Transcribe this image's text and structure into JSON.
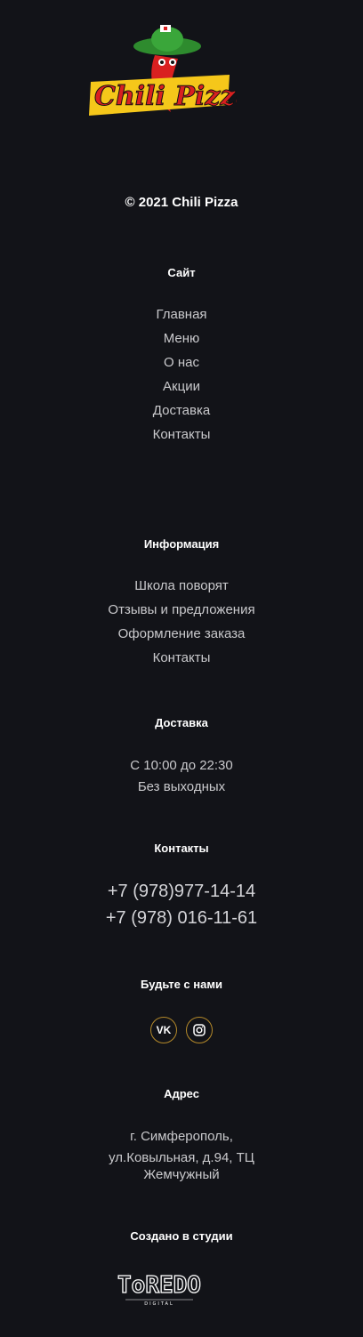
{
  "footer": {
    "logo_text": "Chili Pizza",
    "copyright": "© 2021 Chili Pizza",
    "site": {
      "heading": "Сайт",
      "links": [
        "Главная",
        "Меню",
        "О нас",
        "Акции",
        "Доставка",
        "Контакты"
      ]
    },
    "info": {
      "heading": "Информация",
      "links": [
        "Школа поворят",
        "Отзывы и предложения",
        "Оформление заказа",
        "Контакты"
      ]
    },
    "delivery": {
      "heading": "Доставка",
      "hours": "С 10:00 до 22:30",
      "days": "Без выходных"
    },
    "contacts": {
      "heading": "Контакты",
      "phone1": "+7 (978)977-14-14",
      "phone2": "+7 (978) 016-11-61"
    },
    "social": {
      "heading": "Будьте с нами",
      "vk_label": "VK",
      "instagram_icon": "instagram-icon"
    },
    "address": {
      "heading": "Адрес",
      "line1": "г. Симферополь,",
      "line2": "ул.Ковыльная, д.94, ТЦ",
      "line3": "Жемчужный"
    },
    "studio": {
      "heading": "Создано в студии",
      "name": "ToREDO",
      "sub": "DIGITAL"
    }
  }
}
